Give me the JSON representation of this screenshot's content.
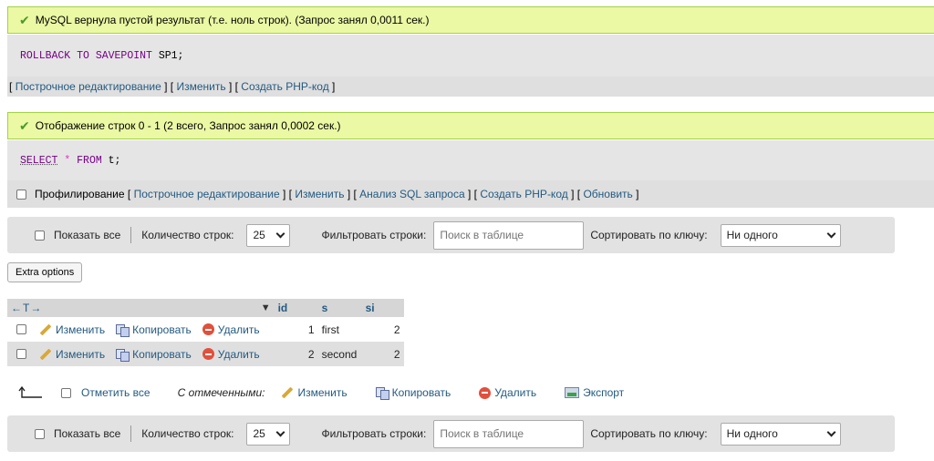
{
  "msg1": {
    "text": "MySQL вернула пустой результат (т.е. ноль строк). (Запрос занял 0,0011 сек.)",
    "sql_kw": "ROLLBACK TO SAVEPOINT",
    "sql_rest": "SP1;",
    "links": {
      "open": "[",
      "inline_edit": "Построчное редактирование",
      "sep1": "] [",
      "edit": "Изменить",
      "sep2": "] [",
      "php": "Создать PHP-код",
      "close": "]"
    }
  },
  "msg2": {
    "text": "Отображение строк 0 - 1 (2 всего, Запрос занял 0,0002 сек.)",
    "sql_select": "SELECT",
    "sql_star": "*",
    "sql_from": "FROM",
    "sql_table": "t;",
    "profiling": "Профилирование",
    "links": {
      "open": "[",
      "inline_edit": "Построчное редактирование",
      "sep1": "] [",
      "edit": "Изменить",
      "sep2": "] [",
      "analyze": "Анализ SQL запроса",
      "sep3": "] [",
      "php": "Создать PHP-код",
      "sep4": "] [",
      "refresh": "Обновить",
      "close": "]"
    }
  },
  "nav": {
    "show_all": "Показать все",
    "rows_label": "Количество строк:",
    "rows_value": "25",
    "filter_label": "Фильтровать строки:",
    "filter_placeholder": "Поиск в таблице",
    "sort_label": "Сортировать по ключу:",
    "sort_value": "Ни одного"
  },
  "extra_options": "Extra options",
  "table": {
    "arrows": "←T→",
    "columns": [
      "id",
      "s",
      "si"
    ],
    "sort_indicator": "▼",
    "actions": {
      "edit": "Изменить",
      "copy": "Копировать",
      "delete": "Удалить"
    },
    "rows": [
      {
        "id": "1",
        "s": "first",
        "si": "2"
      },
      {
        "id": "2",
        "s": "second",
        "si": "2"
      }
    ]
  },
  "bulk": {
    "check_all": "Отметить все",
    "with_selected": "С отмеченными:",
    "edit": "Изменить",
    "copy": "Копировать",
    "delete": "Удалить",
    "export": "Экспорт"
  },
  "colors": {
    "success_bg": "#ebf8a4",
    "link": "#235a81",
    "keyword": "#770088"
  }
}
